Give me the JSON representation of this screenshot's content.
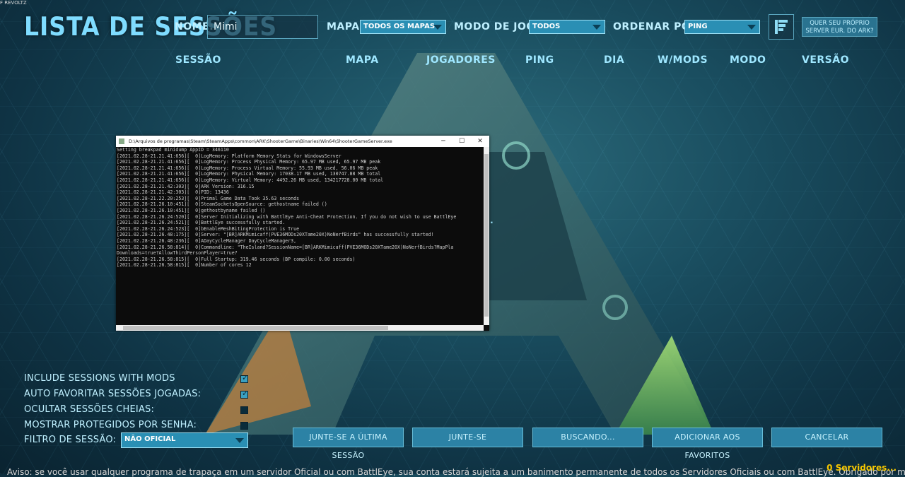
{
  "top_mini": {
    "text": "F REVOLTZ"
  },
  "title": "LISTA DE SESSÕES",
  "filters": {
    "name_label": "NOME:",
    "name_value": "Mimi",
    "map_label": "MAPA:",
    "map_value": "TODOS OS MAPAS",
    "mode_label": "MODO DE JOGO:",
    "mode_value": "TODOS",
    "sort_label": "ORDENAR POR:",
    "sort_value": "PING",
    "promo_button": "QUER SEU PRÓPRIO SERVER EUR. DO ARK?"
  },
  "columns": [
    "SESSÃO",
    "MAPA",
    "JOGADORES",
    "PING",
    "DIA",
    "W/MODS",
    "MODO",
    "VERSÃO"
  ],
  "console": {
    "title": "D:\\Arquivos de programas\\Steam\\SteamApps\\common\\ARK\\ShooterGame\\Binaries\\Win64\\ShooterGameServer.exe",
    "lines": [
      "Setting breakpad minidump AppID = 346110",
      "[2021.02.28-21.21.41:656][  0]LogMemory: Platform Memory Stats for WindowsServer",
      "[2021.02.28-21.21.41:656][  0]LogMemory: Process Physical Memory: 65.97 MB used, 65.97 MB peak",
      "[2021.02.28-21.21.41:656][  0]LogMemory: Process Virtual Memory: 55.93 MB used, 56.06 MB peak",
      "[2021.02.28-21.21.41:656][  0]LogMemory: Physical Memory: 17038.17 MB used, 130747.88 MB total",
      "[2021.02.28-21.21.41:656][  0]LogMemory: Virtual Memory: 4492.26 MB used, 134217728.00 MB total",
      "[2021.02.28-21.21.42:303][  0]ARK Version: 316.15",
      "[2021.02.28-21.21.42:303][  0]PID: 13436",
      "[2021.02.28-21.22.20:253][  0]Primal Game Data Took 35.63 seconds",
      "[2021.02.28-21.26.10:451][  0]SteamSocketsOpenSource: gethostname failed ()",
      "[2021.02.28-21.26.10:451][  0]gethostbyname failed ()",
      "[2021.02.28-21.26.24:520][  0]Server Initializing with BattlEye Anti-Cheat Protection. If you do not wish to use BattlEye",
      "[2021.02.28-21.26.24:521][  0]BattlEye successfully started.",
      "[2021.02.28-21.26.24:523][  0]bEnableMeshBitingProtection is True",
      "[2021.02.28-21.26.48:175][  0]Server: \"[BR]ARKMimicaff(PVE36MODs20XTame20X)NoNerfBirds\" has successfully started!",
      "[2021.02.28-21.26.48:236][  0]ADayCycleManager DayCycleManager3,",
      "[2021.02.28-21.26.58:814][  0]Commandline: \"TheIsland?SessionName=[BR]ARKMimicaff(PVE36MODs20XTame20X)NoNerfBirds?MapPla",
      "Downloads=true?AllowThirdPersonPlayer=true?",
      "[2021.02.28-21.26.58:815][  0]Full Startup: 319.46 seconds (BP compile: 0.00 seconds)",
      "[2021.02.28-21.26.58:815][  0]Number of cores 12"
    ]
  },
  "loading_ellipsis": "...",
  "options": {
    "include_mods": {
      "label": "INCLUDE SESSIONS WITH MODS",
      "checked": true
    },
    "auto_fav": {
      "label": "AUTO FAVORITAR SESSÕES JOGADAS:",
      "checked": true
    },
    "hide_full": {
      "label": "OCULTAR SESSÕES CHEIAS:",
      "checked": false
    },
    "show_protected": {
      "label": "MOSTRAR PROTEGIDOS POR SENHA:",
      "checked": false
    },
    "session_filter_label": "FILTRO DE SESSÃO:",
    "session_filter_value": "NÃO OFICIAL"
  },
  "buttons": {
    "join_last": "JUNTE-SE A ÚLTIMA SESSÃO",
    "join": "JUNTE-SE",
    "searching": "BUSCANDO...",
    "add_fav": "ADICIONAR AOS FAVORITOS",
    "cancel": "CANCELAR"
  },
  "footer": {
    "warning": "Aviso: se você usar qualquer programa de trapaça em um servidor Oficial ou com BattlEye, sua conta estará sujeita a um banimento permanente de todos os Servidores Oficiais ou com BattlEye. Obrigado por manter",
    "server_count": "0 Servidores..."
  },
  "colors": {
    "accent": "#2c82a5",
    "title": "#7fdcff",
    "server_count": "#f7c800"
  }
}
